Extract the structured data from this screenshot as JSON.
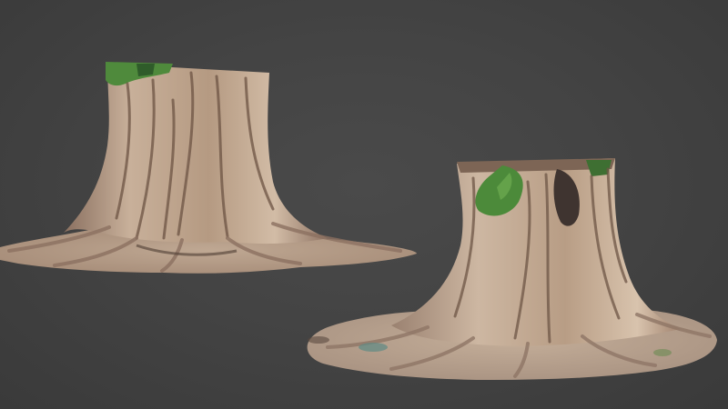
{
  "scene": {
    "background_color": "#444444",
    "objects": [
      {
        "name": "tree-stump-left",
        "kind": "scanned tree stump with spreading roots"
      },
      {
        "name": "tree-stump-right",
        "kind": "scanned tree stump with moss on top"
      }
    ]
  },
  "colors": {
    "bark_light": "#c9b29a",
    "bark_mid": "#a8896f",
    "bark_dark": "#6e5646",
    "moss": "#4c8a3a",
    "ground": "#b9a592"
  }
}
